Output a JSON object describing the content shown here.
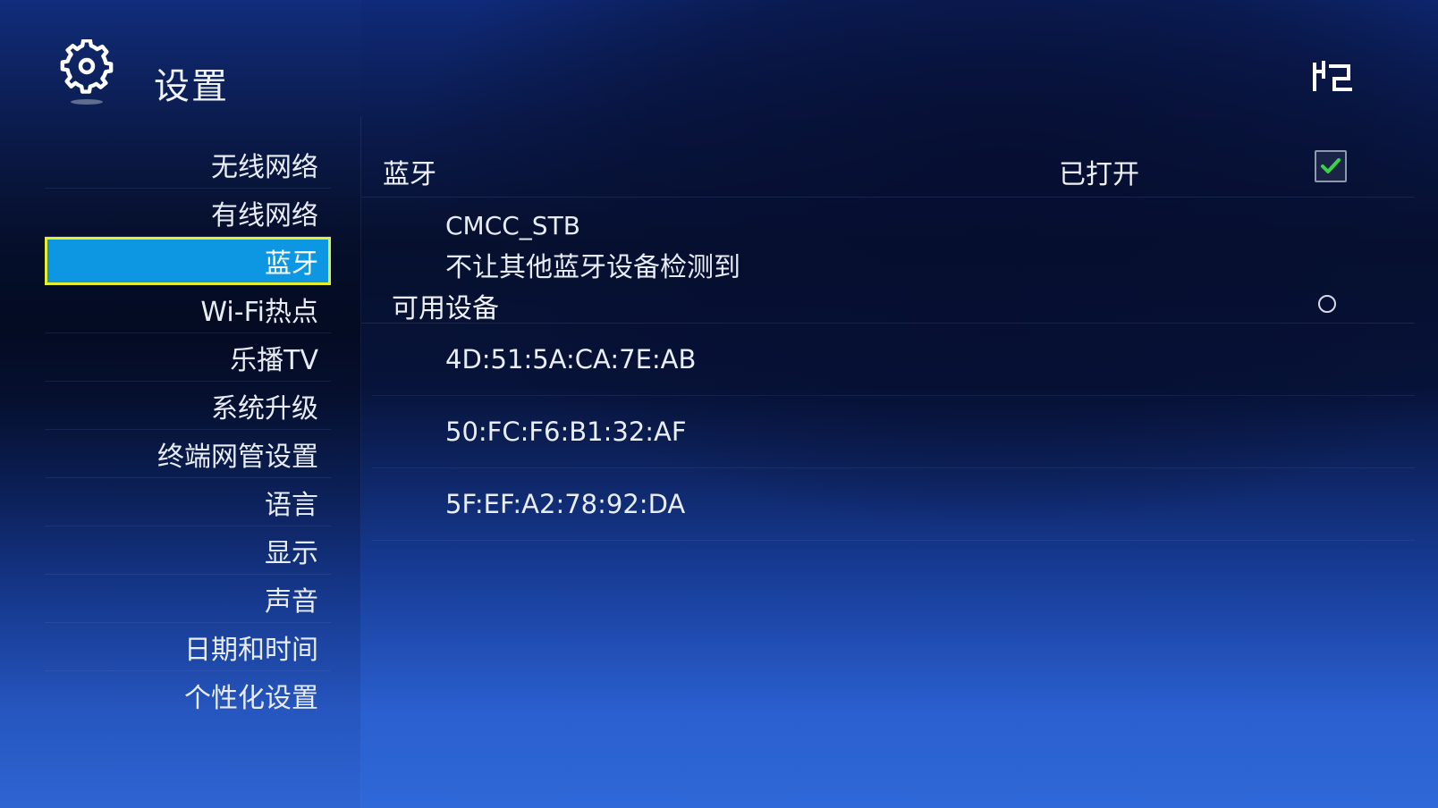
{
  "header": {
    "title": "设置",
    "settings_icon": "gear-icon",
    "corner_icon": "corner-logo-icon"
  },
  "sidebar": {
    "selected_index": 2,
    "items": [
      {
        "label": "无线网络"
      },
      {
        "label": "有线网络"
      },
      {
        "label": "蓝牙"
      },
      {
        "label": "Wi-Fi热点"
      },
      {
        "label": "乐播TV"
      },
      {
        "label": "系统升级"
      },
      {
        "label": "终端网管设置"
      },
      {
        "label": "语言"
      },
      {
        "label": "显示"
      },
      {
        "label": "声音"
      },
      {
        "label": "日期和时间"
      },
      {
        "label": "个性化设置"
      }
    ]
  },
  "bluetooth": {
    "label": "蓝牙",
    "status": "已打开",
    "enabled": true,
    "device_name": "CMCC_STB",
    "visibility_text": "不让其他蓝牙设备检测到",
    "available_label": "可用设备",
    "scanning_icon": "loading-icon",
    "devices": [
      {
        "address": "4D:51:5A:CA:7E:AB"
      },
      {
        "address": "50:FC:F6:B1:32:AF"
      },
      {
        "address": "5F:EF:A2:78:92:DA"
      }
    ]
  },
  "colors": {
    "selected_bg": "#0d97e3",
    "selected_border": "#e5ef2e",
    "check_mark": "#37d448"
  }
}
